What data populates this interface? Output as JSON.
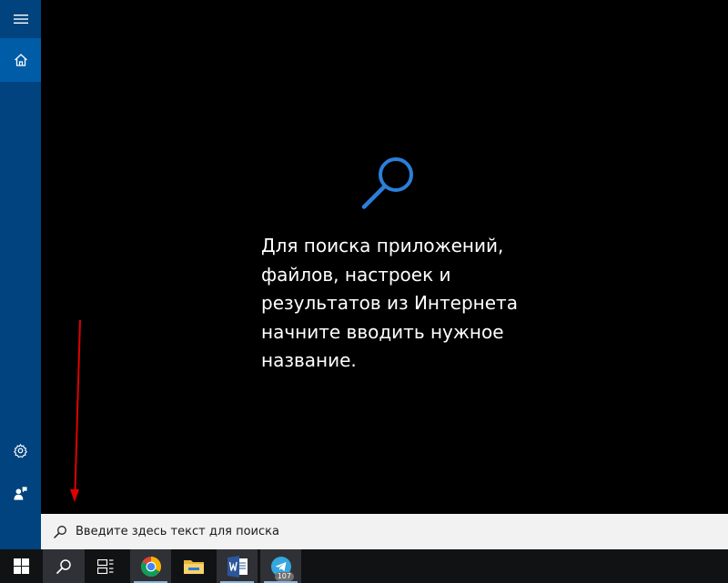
{
  "colors": {
    "sidebar": "#00437e",
    "sidebar_active": "#005ca6",
    "accent": "#2b7fd9",
    "arrow": "#e00000",
    "searchbar": "#f2f2f2",
    "taskbar": "#111214"
  },
  "sidebar": {
    "items": [
      {
        "id": "menu",
        "icon": "hamburger-menu-icon"
      },
      {
        "id": "home",
        "icon": "home-icon",
        "selected": true
      },
      {
        "id": "settings",
        "icon": "gear-icon"
      },
      {
        "id": "feedback",
        "icon": "feedback-person-icon"
      }
    ]
  },
  "main": {
    "icon": "search-icon",
    "hint_lines": [
      "Для поиска приложений,",
      "файлов, настроек и",
      "результатов из Интернета",
      "начните вводить нужное",
      "название."
    ]
  },
  "searchbar": {
    "placeholder": "Введите здесь текст для поиска",
    "icon": "search-icon"
  },
  "taskbar": {
    "items": [
      {
        "id": "start",
        "icon": "windows-logo-icon"
      },
      {
        "id": "search",
        "icon": "search-icon",
        "active": true
      },
      {
        "id": "task-view",
        "icon": "task-view-icon"
      },
      {
        "id": "chrome",
        "icon": "chrome-icon",
        "pinned_open": true
      },
      {
        "id": "explorer",
        "icon": "folder-icon"
      },
      {
        "id": "word",
        "icon": "word-icon",
        "pinned_open": true
      },
      {
        "id": "telegram",
        "icon": "telegram-icon",
        "pinned_open": true,
        "badge": "107"
      }
    ]
  },
  "annotation": {
    "icon": "red-arrow-down-icon"
  }
}
